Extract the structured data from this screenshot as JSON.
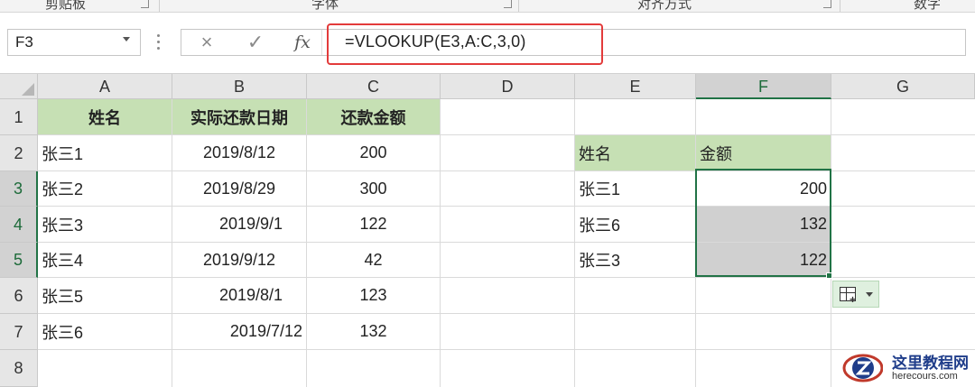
{
  "ribbon": {
    "groups": [
      {
        "label": "剪贴板"
      },
      {
        "label": "字体"
      },
      {
        "label": "对齐方式"
      },
      {
        "label": "数字"
      }
    ]
  },
  "formula_bar": {
    "name_box": "F3",
    "cancel_icon": "×",
    "enter_icon": "✓",
    "fx_label": "fx",
    "formula": "=VLOOKUP(E3,A:C,3,0)"
  },
  "columns": [
    "A",
    "B",
    "C",
    "D",
    "E",
    "F",
    "G"
  ],
  "rows": [
    "1",
    "2",
    "3",
    "4",
    "5",
    "6",
    "7",
    "8"
  ],
  "table1": {
    "headers": [
      "姓名",
      "实际还款日期",
      "还款金额"
    ],
    "rows": [
      {
        "name": "张三1",
        "date": "2019/8/12",
        "amount": "200"
      },
      {
        "name": "张三2",
        "date": "2019/8/29",
        "amount": "300"
      },
      {
        "name": "张三3",
        "date": "2019/9/1",
        "amount": "122"
      },
      {
        "name": "张三4",
        "date": "2019/9/12",
        "amount": "42"
      },
      {
        "name": "张三5",
        "date": "2019/8/1",
        "amount": "123"
      },
      {
        "name": "张三6",
        "date": "2019/7/12",
        "amount": "132"
      }
    ]
  },
  "table2": {
    "headers": [
      "姓名",
      "金额"
    ],
    "rows": [
      {
        "name": "张三1",
        "amount": "200"
      },
      {
        "name": "张三6",
        "amount": "132"
      },
      {
        "name": "张三3",
        "amount": "122"
      }
    ]
  },
  "watermark": {
    "title": "这里教程网",
    "url": "herecours.com"
  },
  "colors": {
    "header_fill": "#c6e0b4",
    "selection_border": "#217346",
    "formula_highlight": "#e33b3b"
  }
}
